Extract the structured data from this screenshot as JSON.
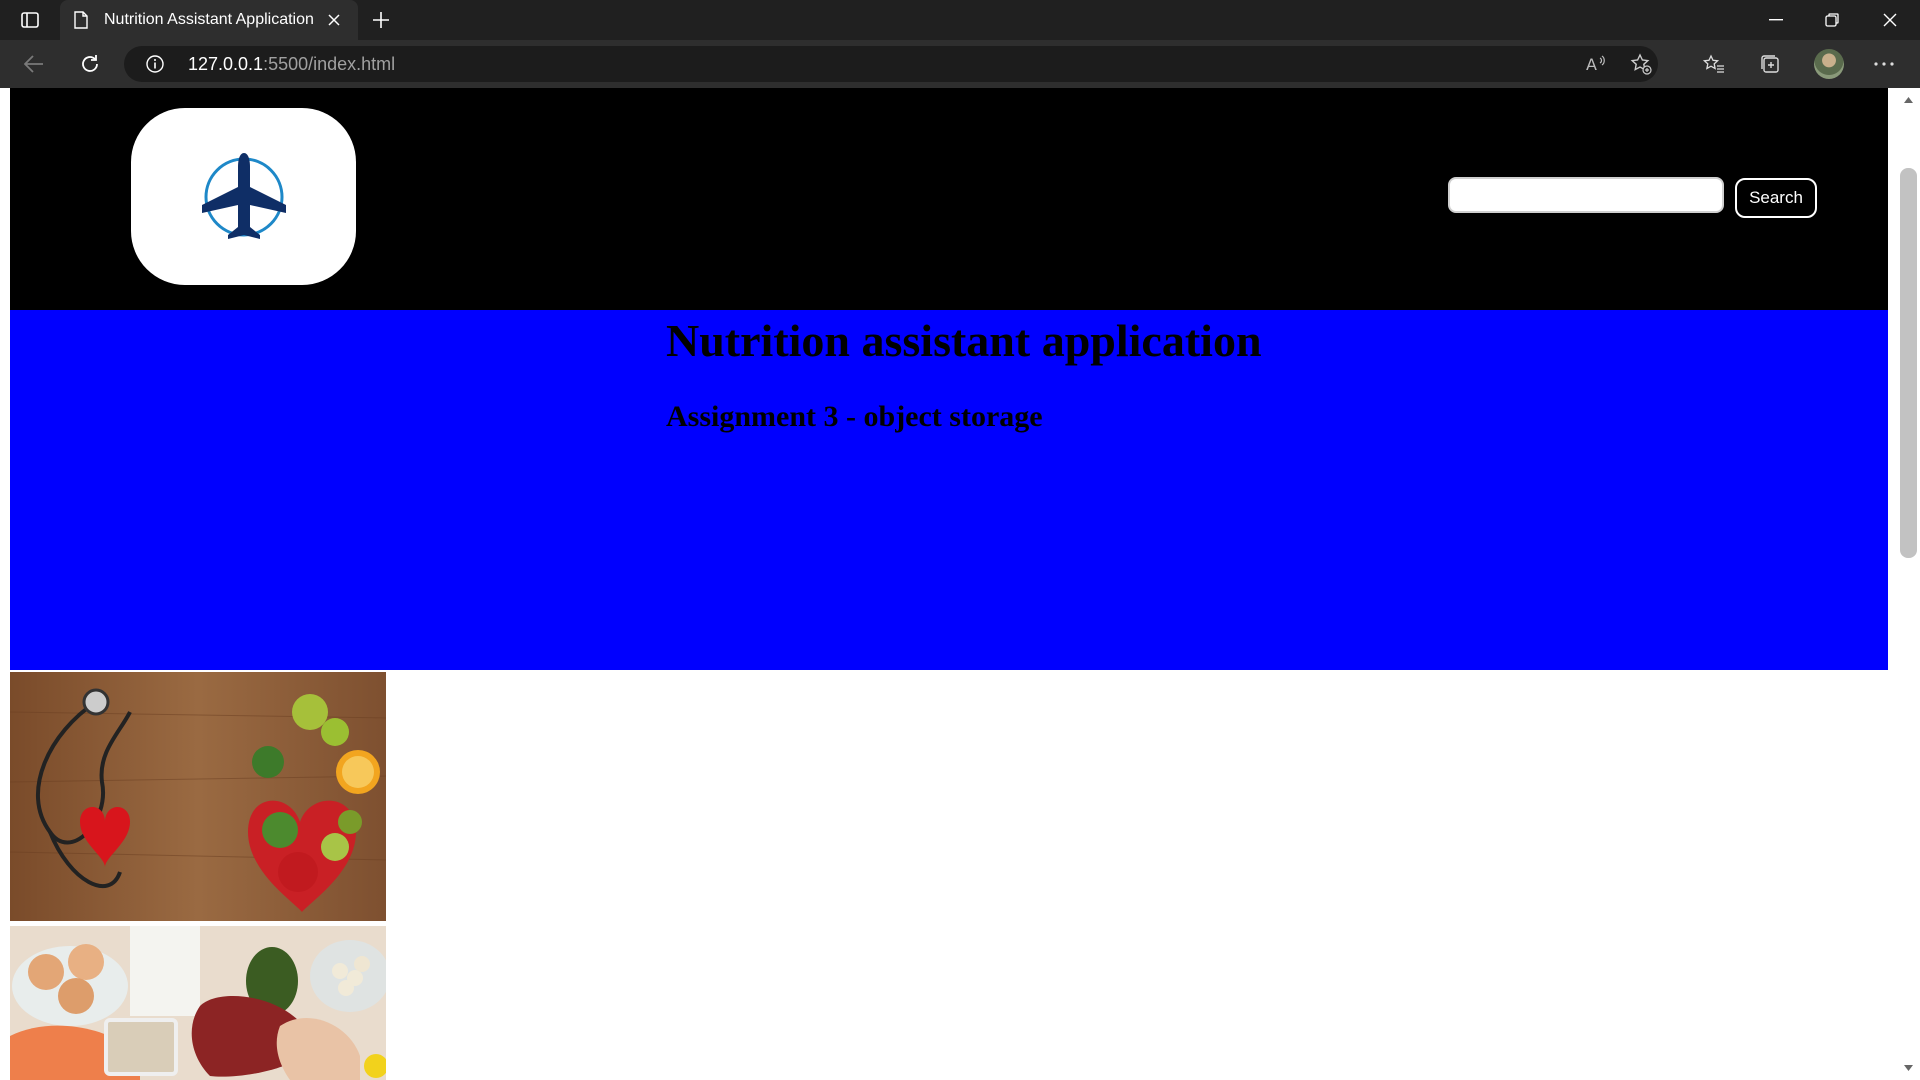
{
  "browser": {
    "tab_title": "Nutrition Assistant Application",
    "url_host": "127.0.0.1",
    "url_rest": ":5500/index.html",
    "icons": [
      "tab-actions-icon",
      "document-icon",
      "close-icon",
      "plus-icon",
      "minimize-icon",
      "restore-icon",
      "window-close-icon",
      "back-icon",
      "refresh-icon",
      "info-icon",
      "read-aloud-icon",
      "add-favorite-icon",
      "favorites-icon",
      "collections-icon",
      "profile-avatar",
      "more-icon"
    ]
  },
  "header": {
    "logo_icon": "airplane-icon",
    "search_value": "",
    "search_button": "Search"
  },
  "banner": {
    "title": "Nutrition assistant application",
    "subtitle": "Assignment 3 - object storage"
  },
  "images": [
    {
      "name": "stethoscope-and-fruits-photo"
    },
    {
      "name": "eggs-meat-fish-photo"
    }
  ],
  "colors": {
    "header_bg": "#000000",
    "banner_bg": "#0000ff",
    "page_bg": "#ffffff",
    "logo_blue": "#0f2e66",
    "logo_ring": "#1e88c8"
  }
}
